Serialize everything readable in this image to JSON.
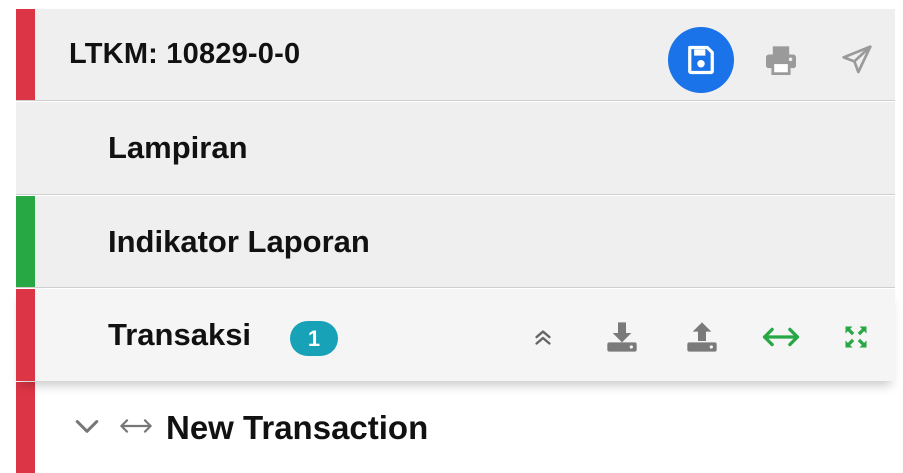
{
  "header": {
    "title": "LTKM: 10829-0-0",
    "accent_color": "#dc3545",
    "actions": [
      "save-icon",
      "print-icon",
      "send-icon"
    ]
  },
  "sections": {
    "lampiran": {
      "label": "Lampiran",
      "accent_color": "#efefef"
    },
    "indikator": {
      "label": "Indikator Laporan",
      "accent_color": "#28a745"
    },
    "transaksi": {
      "label": "Transaksi",
      "count": "1",
      "accent_color": "#dc3545",
      "actions": [
        "collapse-all-icon",
        "download-icon",
        "upload-icon",
        "horizontal-arrows-icon",
        "expand-icon"
      ]
    }
  },
  "transaction": {
    "label": "New Transaction",
    "accent_color": "#dc3545"
  },
  "colors": {
    "primary": "#1a73e8",
    "success": "#28a745",
    "danger": "#dc3545",
    "info": "#17a2b8",
    "muted": "#9a9a9a"
  }
}
